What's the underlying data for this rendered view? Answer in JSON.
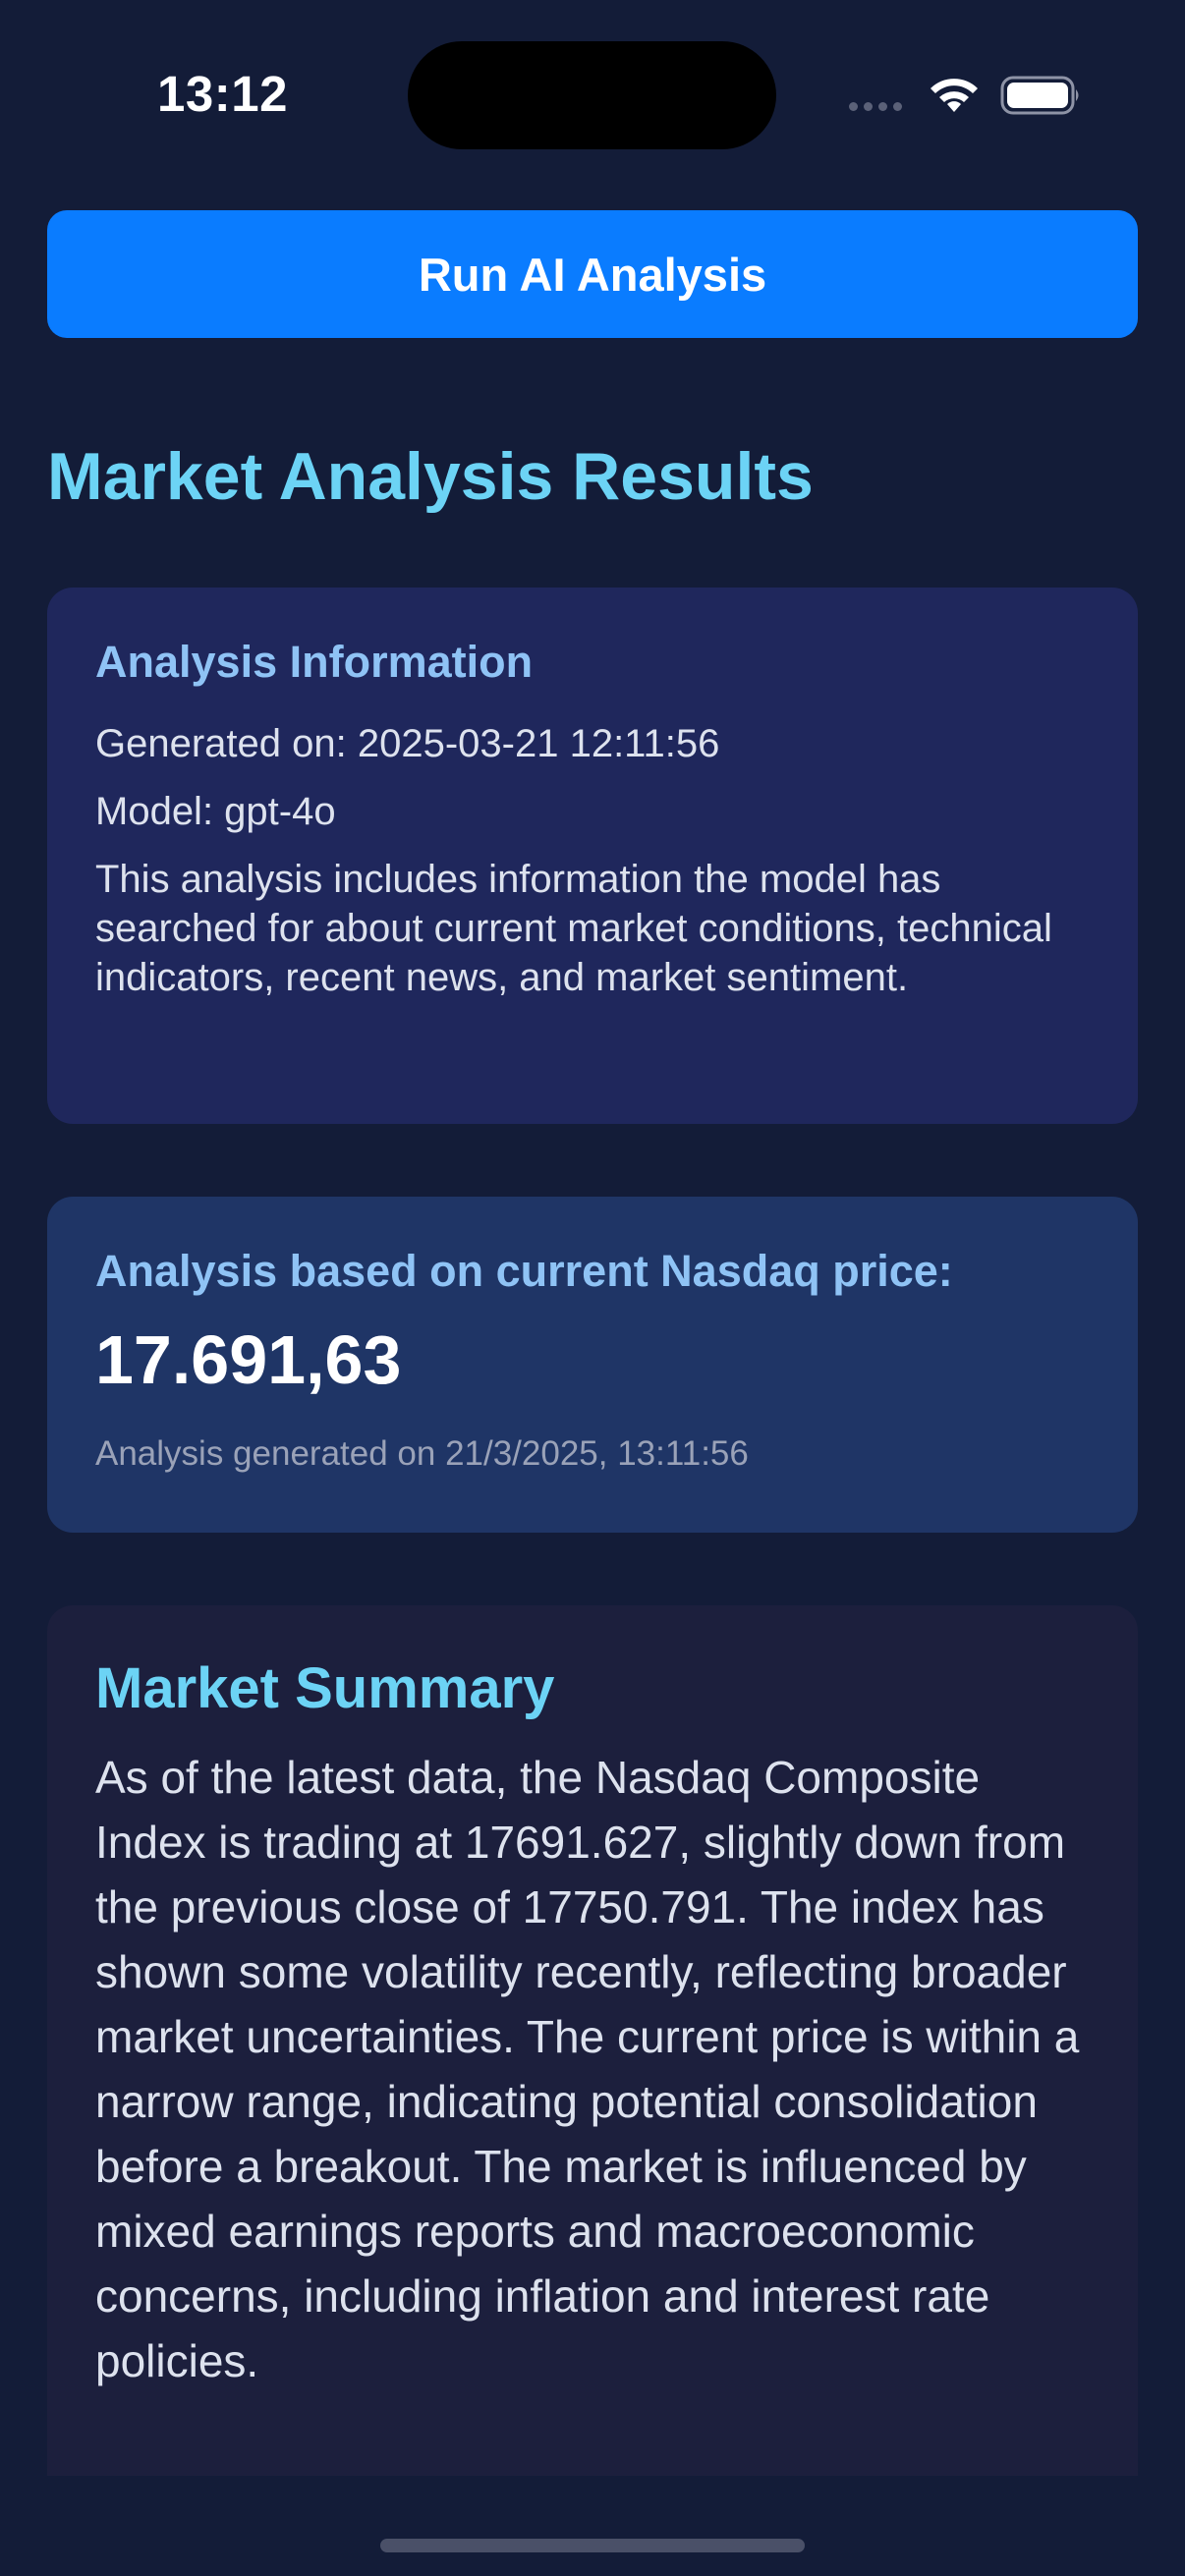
{
  "status_bar": {
    "time": "13:12"
  },
  "actions": {
    "run_label": "Run AI Analysis"
  },
  "page": {
    "title": "Market Analysis Results"
  },
  "analysis_info": {
    "heading": "Analysis Information",
    "generated": "Generated on: 2025-03-21 12:11:56",
    "model": "Model: gpt-4o",
    "description": "This analysis includes information the model has searched for about current market conditions, technical indicators, recent news, and market sentiment."
  },
  "price_card": {
    "heading": "Analysis based on current Nasdaq price:",
    "price": "17.691,63",
    "timestamp": "Analysis generated on 21/3/2025, 13:11:56"
  },
  "summary": {
    "title": "Market Summary",
    "text": "As of the latest data, the Nasdaq Composite Index is trading at 17691.627, slightly down from the previous close of 17750.791. The index has shown some volatility recently, reflecting broader market uncertainties. The current price is within a narrow range, indicating potential consolidation before a breakout. The market is influenced by mixed earnings reports and macroeconomic concerns, including inflation and interest rate policies."
  },
  "colors": {
    "background": "#131c38",
    "accent_blue": "#0a7cff",
    "title_cyan": "#6cd3f5",
    "heading_blue": "#8fc3f5"
  },
  "icons": {
    "wifi": "wifi-icon",
    "battery": "battery-icon",
    "signal": "signal-dots-icon"
  }
}
